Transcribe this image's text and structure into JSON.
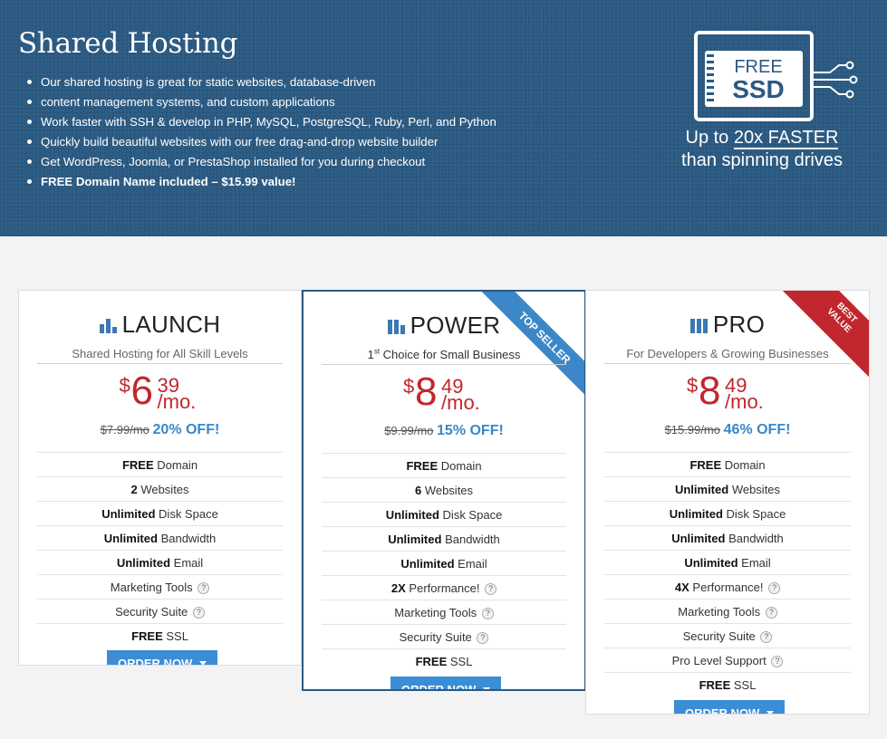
{
  "hero": {
    "title": "Shared Hosting",
    "bullets": [
      "Our shared hosting is great for static websites, database-driven",
      "content management systems, and custom applications",
      "Work faster with SSH & develop in PHP, MySQL, PostgreSQL, Ruby, Perl, and Python",
      "Quickly build beautiful websites with our free drag-and-drop website builder",
      "Get WordPress, Joomla, or PrestaShop installed for you during checkout",
      "FREE Domain Name included – $15.99 value!"
    ],
    "ssd": {
      "free": "FREE",
      "ssd": "SSD",
      "line1_prefix": "Up to",
      "line1_big": "20x FASTER",
      "line2": "than spinning drives"
    }
  },
  "plans": [
    {
      "name": "LAUNCH",
      "subtitle": "Shared Hosting for All Skill Levels",
      "price_currency": "$",
      "price_whole": "6",
      "price_cents": "39",
      "price_period": "/mo.",
      "old_price": "$7.99/mo",
      "discount": "20% OFF!",
      "features": [
        {
          "bold": "FREE",
          "text": "Domain"
        },
        {
          "bold": "2",
          "text": "Websites"
        },
        {
          "bold": "Unlimited",
          "text": "Disk Space"
        },
        {
          "bold": "Unlimited",
          "text": "Bandwidth"
        },
        {
          "bold": "Unlimited",
          "text": "Email"
        },
        {
          "bold": "",
          "text": "Marketing Tools"
        },
        {
          "bold": "",
          "text": "Security Suite"
        },
        {
          "bold": "FREE",
          "text": "SSL"
        }
      ],
      "order_label": "ORDER NOW"
    },
    {
      "name": "POWER",
      "subtitle_sup": "st",
      "subtitle_num": "1",
      "subtitle_rest": "Choice for Small Business",
      "ribbon": "TOP SELLER",
      "price_currency": "$",
      "price_whole": "8",
      "price_cents": "49",
      "price_period": "/mo.",
      "old_price": "$9.99/mo",
      "discount": "15% OFF!",
      "features": [
        {
          "bold": "FREE",
          "text": "Domain"
        },
        {
          "bold": "6",
          "text": "Websites"
        },
        {
          "bold": "Unlimited",
          "text": "Disk Space"
        },
        {
          "bold": "Unlimited",
          "text": "Bandwidth"
        },
        {
          "bold": "Unlimited",
          "text": "Email"
        },
        {
          "bold": "2X",
          "text": "Performance!"
        },
        {
          "bold": "",
          "text": "Marketing Tools"
        },
        {
          "bold": "",
          "text": "Security Suite"
        },
        {
          "bold": "FREE",
          "text": "SSL"
        }
      ],
      "order_label": "ORDER NOW"
    },
    {
      "name": "PRO",
      "subtitle": "For Developers & Growing Businesses",
      "ribbon_line1": "BEST",
      "ribbon_line2": "VALUE",
      "price_currency": "$",
      "price_whole": "8",
      "price_cents": "49",
      "price_period": "/mo.",
      "old_price": "$15.99/mo",
      "discount": "46% OFF!",
      "features": [
        {
          "bold": "FREE",
          "text": "Domain"
        },
        {
          "bold": "Unlimited",
          "text": "Websites"
        },
        {
          "bold": "Unlimited",
          "text": "Disk Space"
        },
        {
          "bold": "Unlimited",
          "text": "Bandwidth"
        },
        {
          "bold": "Unlimited",
          "text": "Email"
        },
        {
          "bold": "4X",
          "text": "Performance!"
        },
        {
          "bold": "",
          "text": "Marketing Tools"
        },
        {
          "bold": "",
          "text": "Security Suite"
        },
        {
          "bold": "",
          "text": "Pro Level Support"
        },
        {
          "bold": "FREE",
          "text": "SSL"
        }
      ],
      "order_label": "ORDER NOW"
    }
  ],
  "help_glyph": "?",
  "colors": {
    "hero_bg": "#2b5a82",
    "price_red": "#c1272d",
    "accent_blue": "#3b87c8",
    "button_blue": "#3b8dd6"
  }
}
